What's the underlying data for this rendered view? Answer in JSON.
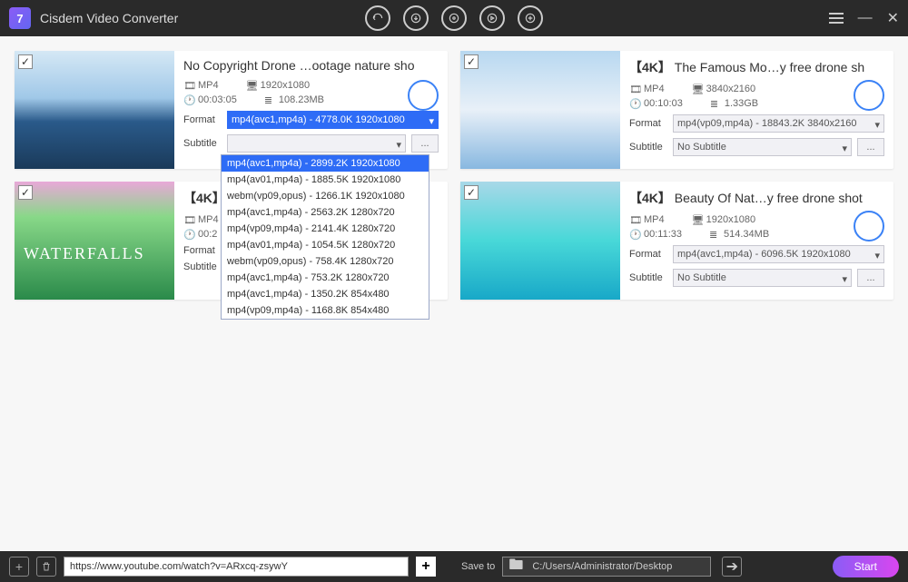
{
  "app": {
    "title": "Cisdem Video Converter"
  },
  "videos": [
    {
      "title": "No Copyright Drone …ootage nature sho",
      "badge": "",
      "container": "MP4",
      "resolution": "1920x1080",
      "duration": "00:03:05",
      "size": "108.23MB",
      "format_label": "Format",
      "subtitle_label": "Subtitle",
      "format_value": "mp4(avc1,mp4a) - 4778.0K 1920x1080",
      "subtitle_value": ""
    },
    {
      "title": "The Famous Mo…y free drone sh",
      "badge": "【4K】",
      "container": "MP4",
      "resolution": "3840x2160",
      "duration": "00:10:03",
      "size": "1.33GB",
      "format_label": "Format",
      "subtitle_label": "Subtitle",
      "format_value": "mp4(vp09,mp4a) - 18843.2K 3840x2160",
      "subtitle_value": "No Subtitle"
    },
    {
      "title": "",
      "badge": "【4K】",
      "container": "MP4",
      "resolution": "",
      "duration": "00:2",
      "size": "",
      "format_label": "Format",
      "subtitle_label": "Subtitle",
      "format_value": "",
      "subtitle_value": "No Subtitle"
    },
    {
      "title": "Beauty Of Nat…y free drone shot",
      "badge": "【4K】",
      "container": "MP4",
      "resolution": "1920x1080",
      "duration": "00:11:33",
      "size": "514.34MB",
      "format_label": "Format",
      "subtitle_label": "Subtitle",
      "format_value": "mp4(avc1,mp4a) - 6096.5K 1920x1080",
      "subtitle_value": "No Subtitle"
    }
  ],
  "dropdown_options": [
    "mp4(avc1,mp4a) - 2899.2K 1920x1080",
    "mp4(av01,mp4a) - 1885.5K 1920x1080",
    "webm(vp09,opus) - 1266.1K 1920x1080",
    "mp4(avc1,mp4a) - 2563.2K 1280x720",
    "mp4(vp09,mp4a) - 2141.4K 1280x720",
    "mp4(av01,mp4a) - 1054.5K 1280x720",
    "webm(vp09,opus) - 758.4K 1280x720",
    "mp4(avc1,mp4a) - 753.2K 1280x720",
    "mp4(avc1,mp4a) - 1350.2K 854x480",
    "mp4(vp09,mp4a) - 1168.8K 854x480"
  ],
  "bottombar": {
    "url": "https://www.youtube.com/watch?v=ARxcq-zsywY",
    "saveto_label": "Save to",
    "saveto_path": "C:/Users/Administrator/Desktop",
    "start": "Start"
  },
  "more_btn": "..."
}
